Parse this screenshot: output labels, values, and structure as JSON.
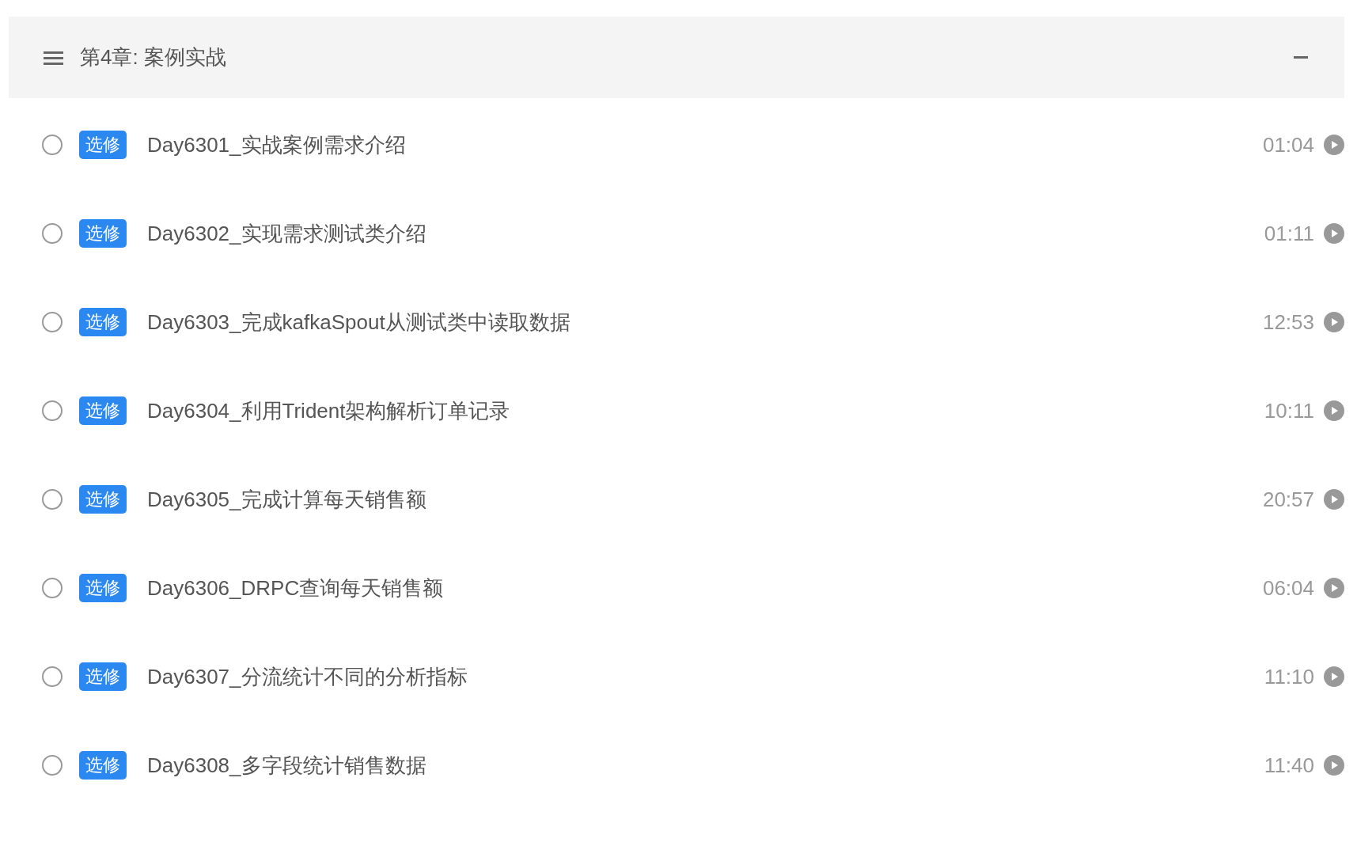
{
  "chapter": {
    "title": "第4章: 案例实战",
    "expanded": true,
    "lessons": [
      {
        "checked": false,
        "tag": "选修",
        "title": "Day6301_实战案例需求介绍",
        "duration": "01:04"
      },
      {
        "checked": false,
        "tag": "选修",
        "title": "Day6302_实现需求测试类介绍",
        "duration": "01:11"
      },
      {
        "checked": false,
        "tag": "选修",
        "title": "Day6303_完成kafkaSpout从测试类中读取数据",
        "duration": "12:53"
      },
      {
        "checked": false,
        "tag": "选修",
        "title": "Day6304_利用Trident架构解析订单记录",
        "duration": "10:11"
      },
      {
        "checked": false,
        "tag": "选修",
        "title": "Day6305_完成计算每天销售额",
        "duration": "20:57"
      },
      {
        "checked": false,
        "tag": "选修",
        "title": "Day6306_DRPC查询每天销售额",
        "duration": "06:04"
      },
      {
        "checked": false,
        "tag": "选修",
        "title": "Day6307_分流统计不同的分析指标",
        "duration": "11:10"
      },
      {
        "checked": false,
        "tag": "选修",
        "title": "Day6308_多字段统计销售数据",
        "duration": "11:40"
      }
    ]
  }
}
